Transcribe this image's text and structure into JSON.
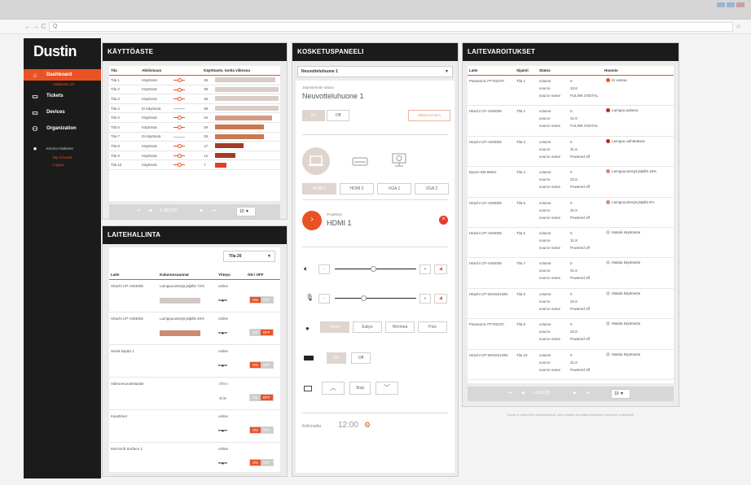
{
  "browser": {
    "address": "Q",
    "nav": "← → C"
  },
  "sidebar": {
    "logo": "Dustin",
    "items": [
      {
        "label": "Dashboard",
        "icon": "home-icon"
      },
      {
        "label": "Tickets",
        "icon": "ticket-icon"
      },
      {
        "label": "Devices",
        "icon": "devices-icon"
      },
      {
        "label": "Organization",
        "icon": "organization-icon"
      }
    ],
    "dashboard_sub": "Saikkosto 13",
    "user_name": "Kimmo Kärkinen",
    "my_account": "My Account",
    "logout": "Logout"
  },
  "usage": {
    "title": "KÄYTTÖASTE",
    "headers": [
      "Tila",
      "Aktiivisuus",
      "Käyttöaste, tuntia viikossa"
    ],
    "rows": [
      {
        "room": "Tila 1",
        "status": "Käytössä",
        "active": true,
        "value": "36",
        "hours": 36
      },
      {
        "room": "Tila 2",
        "status": "Käytössä",
        "active": true,
        "value": "38",
        "hours": 38
      },
      {
        "room": "Tila 3",
        "status": "Käytössä",
        "active": true,
        "value": "38",
        "hours": 38
      },
      {
        "room": "Tila 4",
        "status": "Ei käytössä",
        "active": false,
        "value": "38",
        "hours": 38
      },
      {
        "room": "Tila 5",
        "status": "Käytössä",
        "active": true,
        "value": "34",
        "hours": 34
      },
      {
        "room": "Tila 6",
        "status": "Käytössä",
        "active": true,
        "value": "29",
        "hours": 29
      },
      {
        "room": "Tila 7",
        "status": "Ei käytössä",
        "active": false,
        "value": "29",
        "hours": 29
      },
      {
        "room": "Tila 8",
        "status": "Käytössä",
        "active": true,
        "value": "17",
        "hours": 17
      },
      {
        "room": "Tila 9",
        "status": "Käytössä",
        "active": true,
        "value": "12",
        "hours": 12
      },
      {
        "room": "Tila 10",
        "status": "Käytössä",
        "active": true,
        "value": "7",
        "hours": 7
      }
    ],
    "bar_colors": [
      "#d9ccc6",
      "#d9ccc6",
      "#d9ccc6",
      "#d9ccc6",
      "#d49a85",
      "#c8794f",
      "#c8794f",
      "#a53a25",
      "#a53a25",
      "#e0402a"
    ],
    "pager": {
      "range": "1-10(120)",
      "per_page": "10"
    }
  },
  "device_mgmt": {
    "title": "LAITEHALLINTA",
    "filter": "Tila 26",
    "headers": [
      "Laite",
      "Kulunnosuunnat",
      "Yhteys",
      "ON / OFF"
    ],
    "rows": [
      {
        "device": "Hitachi CP-AW3005",
        "note": "Lamppuuntenjä jäljellä 72%",
        "conn": "online",
        "on": true,
        "bar": "#d2c7c3"
      },
      {
        "device": "Hitachi CP-AW3005",
        "note": "Lamppuuntenjä jäljellä 45%",
        "conn": "online",
        "on": false,
        "bar": "#cf8a73"
      },
      {
        "device": "Seinä käyttä 1",
        "note": "",
        "conn": "online",
        "on": true,
        "bar": ""
      },
      {
        "device": "Videoneuvottelulaite",
        "note": "",
        "conn": "offline",
        "on": false,
        "bar": ""
      },
      {
        "device": "Kaiuttimet",
        "note": "",
        "conn": "online",
        "on": true,
        "bar": ""
      },
      {
        "device": "Microsoft Surface 1",
        "note": "",
        "conn": "online",
        "on": true,
        "bar": ""
      }
    ],
    "on_label": "ON",
    "off_label": "OFF"
  },
  "touch_panel": {
    "title": "KOSKETUSPANEELI",
    "room": "Neuvotteluhuone 1",
    "status_label": "Järjestelmän status",
    "status_value": "Neuvotteluhuone 1",
    "on": "On",
    "off": "Off",
    "reset": "Näkäsoveiden",
    "inputs": [
      "HDMI 1",
      "HDMI 2",
      "VGA 1",
      "VGA 2"
    ],
    "projector_label": "Projektori",
    "projector_input": "HDMI 1",
    "light_buttons": [
      "Flash",
      "Esitys",
      "Himmeä",
      "Pois"
    ],
    "screen_stop": "Stop",
    "clock_label": "Kellonaika",
    "clock": "12:00"
  },
  "alerts": {
    "title": "LAITEVAROITUKSET",
    "headers": [
      "Laite",
      "Sijainti",
      "Status",
      "Huomio"
    ],
    "rows": [
      {
        "device": "Panasonic PT-RZ370",
        "room": "Tila 1",
        "status": [
          [
            "volume",
            "0"
          ],
          [
            "source",
            "32.8"
          ],
          [
            "source name",
            "FULINK DIGITAL"
          ]
        ],
        "note": "Ei vastaa",
        "color": "#e95324"
      },
      {
        "device": "Hitachi CP-AW3005",
        "room": "Tila 2",
        "status": [
          [
            "volume",
            "0"
          ],
          [
            "source",
            "31.8"
          ],
          [
            "source name",
            "FULINK DIGITAL"
          ]
        ],
        "note": "Lamppu palanut",
        "color": "#b0301f"
      },
      {
        "device": "Hitachi CP-AW3005",
        "room": "Tila 3",
        "status": [
          [
            "volume",
            "0"
          ],
          [
            "source",
            "31.8"
          ],
          [
            "source name",
            "Powered off"
          ]
        ],
        "note": "Lamppu vaihdettava",
        "color": "#b0301f"
      },
      {
        "device": "Epson EB-696UI",
        "room": "Tila 4",
        "status": [
          [
            "volume",
            "0"
          ],
          [
            "source",
            "32.8"
          ],
          [
            "source name",
            "Powered off"
          ]
        ],
        "note": "Lamppuuntenjä jäljellä 15%",
        "color": "#d48a70"
      },
      {
        "device": "Hitachi CP-AW3005",
        "room": "Tila 5",
        "status": [
          [
            "volume",
            "0"
          ],
          [
            "source",
            "31.8"
          ],
          [
            "source name",
            "Powered off"
          ]
        ],
        "note": "Lamppuuntenjä jäljellä 8%",
        "color": "#d48a70"
      },
      {
        "device": "Hitachi CP-AW3005",
        "room": "Tila 6",
        "status": [
          [
            "volume",
            "0"
          ],
          [
            "source",
            "31.8"
          ],
          [
            "source name",
            "Powered off"
          ]
        ],
        "note": "Matala käyttöaste",
        "color": "#cfcfcf"
      },
      {
        "device": "Hitachi CP-AW3005",
        "room": "Tila 7",
        "status": [
          [
            "volume",
            "0"
          ],
          [
            "source",
            "31.8"
          ],
          [
            "source name",
            "Powered off"
          ]
        ],
        "note": "Matala käyttöaste",
        "color": "#cfcfcf"
      },
      {
        "device": "Hitachi CP-WX4041WN",
        "room": "Tila 8",
        "status": [
          [
            "volume",
            "0"
          ],
          [
            "source",
            "32.8"
          ],
          [
            "source name",
            "Powered off"
          ]
        ],
        "note": "Matala käyttöaste",
        "color": "#cfcfcf"
      },
      {
        "device": "Panasonic PT-RZ370",
        "room": "Tila 9",
        "status": [
          [
            "volume",
            "0"
          ],
          [
            "source",
            "32.8"
          ],
          [
            "source name",
            "Powered off"
          ]
        ],
        "note": "Matala käyttöaste",
        "color": "#cfcfcf"
      },
      {
        "device": "Hitachi CP-WX4041WN",
        "room": "Tila 10",
        "status": [
          [
            "volume",
            "0"
          ],
          [
            "source",
            "31.8"
          ],
          [
            "source name",
            "Powered off"
          ]
        ],
        "note": "Matala käyttöaste",
        "color": "#cfcfcf"
      }
    ],
    "pager": {
      "range": "1-10(120)",
      "per_page": "10"
    },
    "footnote": "Tämä on esimerkki dashboardista, jota voidaan muokata käyttäjien tarpeiden mukaisesti."
  },
  "colors": {
    "accent": "#e95324",
    "dark": "#1b1b1b"
  }
}
